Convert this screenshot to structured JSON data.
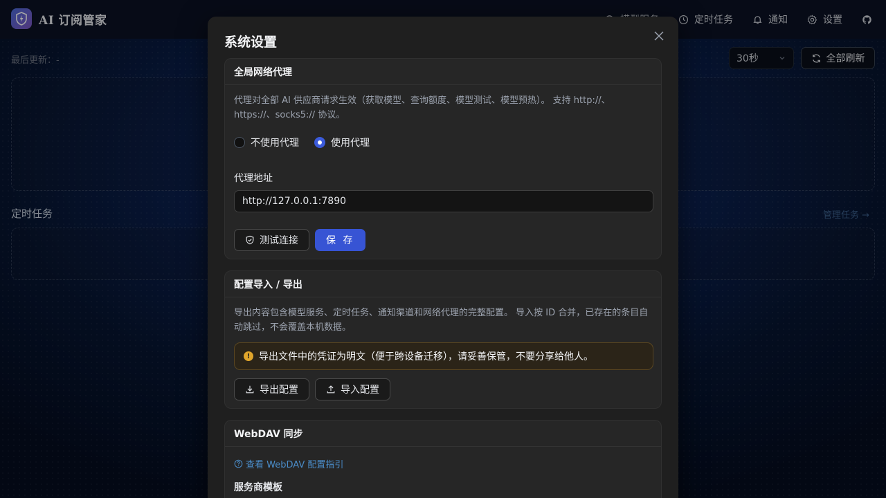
{
  "app": {
    "name": "AI 订阅管家"
  },
  "nav": {
    "items": [
      {
        "label": "模型服务",
        "icon": "model-icon"
      },
      {
        "label": "定时任务",
        "icon": "clock-icon"
      },
      {
        "label": "通知",
        "icon": "bell-icon"
      },
      {
        "label": "设置",
        "icon": "gear-icon"
      }
    ],
    "github_icon": "github-icon"
  },
  "page": {
    "last_update_label": "最后更新：-",
    "interval_value": "30秒",
    "refresh_label": "全部刷新",
    "tasks_title": "定时任务",
    "manage_tasks_label": "管理任务 →"
  },
  "modal": {
    "title": "系统设置",
    "proxy": {
      "title": "全局网络代理",
      "description": "代理对全部 AI 供应商请求生效（获取模型、查询额度、模型测试、模型预热）。 支持 http://、https://、socks5:// 协议。",
      "option_off": "不使用代理",
      "option_on": "使用代理",
      "selected": "on",
      "address_label": "代理地址",
      "address_value": "http://127.0.0.1:7890",
      "test_label": "测试连接",
      "save_label": "保 存"
    },
    "config": {
      "title": "配置导入 / 导出",
      "description": "导出内容包含模型服务、定时任务、通知渠道和网络代理的完整配置。 导入按 ID 合并，已存在的条目自动跳过，不会覆盖本机数据。",
      "warning": "导出文件中的凭证为明文（便于跨设备迁移），请妥善保管，不要分享给他人。",
      "export_label": "导出配置",
      "import_label": "导入配置"
    },
    "webdav": {
      "title": "WebDAV 同步",
      "guide_link": "查看 WebDAV 配置指引",
      "template_label": "服务商模板"
    }
  },
  "colors": {
    "primary": "#3754d4",
    "warning": "#e0a52b",
    "link": "#4a8cc8"
  }
}
